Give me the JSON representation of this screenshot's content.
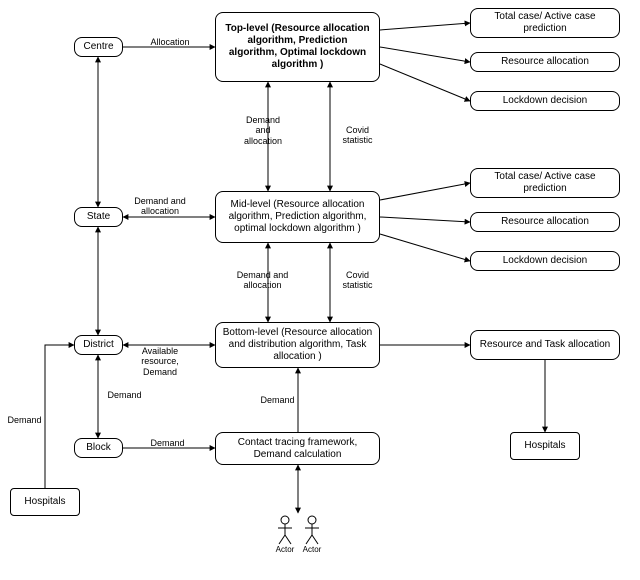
{
  "nodes": {
    "centre": "Centre",
    "state": "State",
    "district": "District",
    "block": "Block",
    "hospitals_left": "Hospitals",
    "top_level": "Top-level\n(Resource allocation\nalgorithm, Prediction\nalgorithm, Optimal lockdown\nalgorithm )",
    "mid_level": "Mid-level (Resource\nallocation algorithm,\nPrediction algorithm, optimal\nlockdown algorithm )",
    "bottom_level": "Bottom-level (Resource\nallocation and distribution\nalgorithm, Task allocation )",
    "contact_tracing": "Contact tracing framework,\nDemand calculation",
    "out_top_pred": "Total  case/ Active case\nprediction",
    "out_top_res": "Resource allocation",
    "out_top_lock": "Lockdown decision",
    "out_mid_pred": "Total  case/ Active case\nprediction",
    "out_mid_res": "Resource  allocation",
    "out_mid_lock": "Lockdown decision",
    "out_bot_res": "Resource and Task\nallocation",
    "hospitals_right": "Hospitals"
  },
  "edges": {
    "allocation": "Allocation",
    "demand_alloc_top": "Demand\nand\nallocation",
    "covid_stat_top": "Covid\nstatistic",
    "demand_alloc_left": "Demand and\nallocation",
    "demand_alloc_mid": "Demand and\nallocation",
    "covid_stat_mid": "Covid\nstatistic",
    "available_res": "Available\nresource,\nDemand",
    "demand_db": "Demand",
    "demand_block": "Demand",
    "demand_ct": "Demand",
    "demand_hosp": "Demand"
  },
  "actor": "Actor"
}
